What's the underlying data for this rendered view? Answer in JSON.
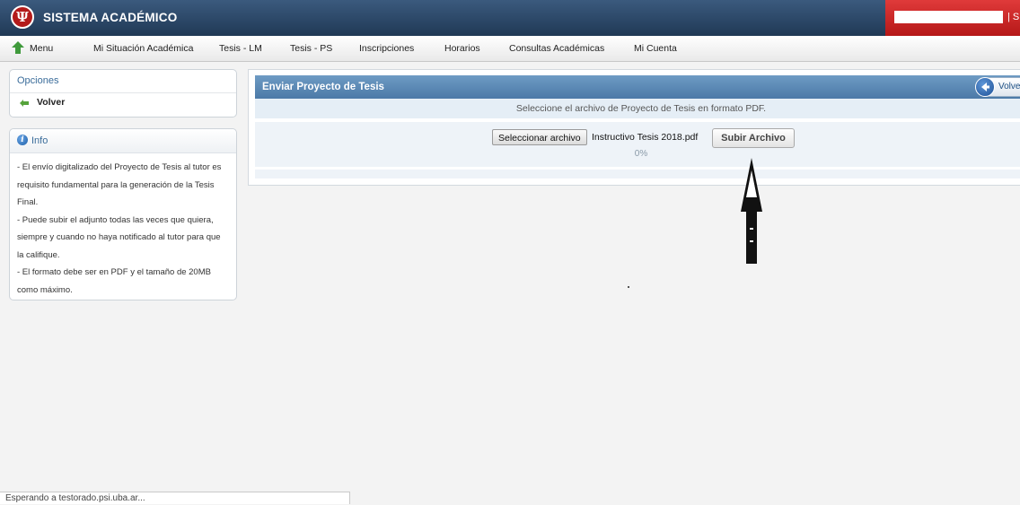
{
  "header": {
    "title": "SISTEMA ACADÉMICO",
    "logo_glyph": "Ψ",
    "user_separator": "| S"
  },
  "nav": {
    "home_label": "Menu",
    "items": [
      "Mi Situación Académica",
      "Tesis - LM",
      "Tesis - PS",
      "Inscripciones",
      "Horarios",
      "Consultas Académicas",
      "Mi Cuenta"
    ]
  },
  "options": {
    "title": "Opciones",
    "back_label": "Volver"
  },
  "info": {
    "title": "Info",
    "text": "- El envío digitalizado del Proyecto de Tesis al tutor es requisito fundamental para la generación de la Tesis Final.\n- Puede subir el adjunto todas las veces que quiera, siempre y cuando no haya notificado al tutor para que la califique.\n- El formato debe ser en PDF y el tamaño de 20MB como máximo."
  },
  "main": {
    "title": "Enviar Proyecto de Tesis",
    "back_button": "Volver",
    "hint": "Seleccione el archivo de Proyecto de Tesis en formato PDF.",
    "file_button": "Seleccionar archivo",
    "file_name": "Instructivo Tesis  2018.pdf",
    "submit_button": "Subir Archivo",
    "progress_text": "0%",
    "progress": 0
  },
  "status": {
    "text": "Esperando a testorado.psi.uba.ar..."
  },
  "colors": {
    "topbar": "#2b4a6f",
    "accent_red": "#c62828",
    "panel_head": "#5a88b5"
  },
  "icons": [
    "psi-logo-icon",
    "home-arrow-icon",
    "back-arrow-icon",
    "info-icon",
    "back-circle-icon",
    "up-arrow-icon"
  ]
}
